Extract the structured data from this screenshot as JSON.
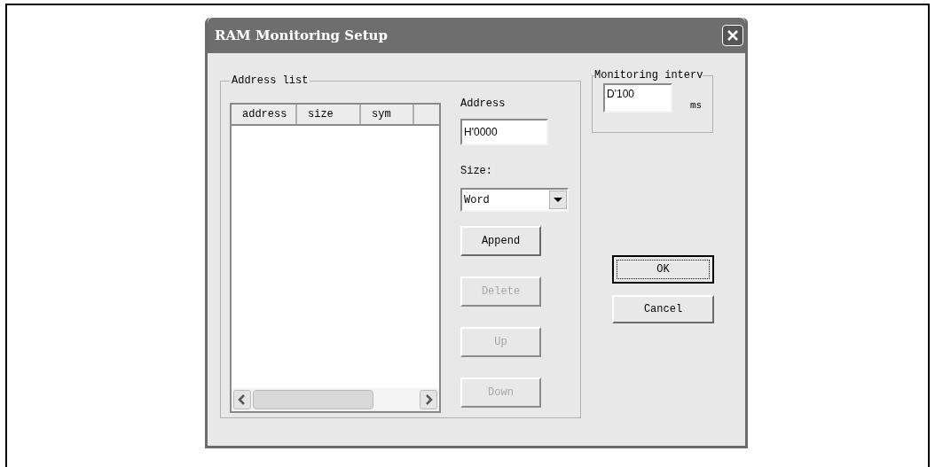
{
  "window": {
    "title": "RAM Monitoring Setup"
  },
  "address_list": {
    "label": "Address list",
    "columns": [
      "address",
      "size",
      "sym"
    ]
  },
  "address": {
    "label": "Address",
    "value": "H'0000"
  },
  "size": {
    "label": "Size:",
    "value": "Word"
  },
  "list_buttons": [
    {
      "label": "Append",
      "disabled": false
    },
    {
      "label": "Delete",
      "disabled": true
    },
    {
      "label": "Up",
      "disabled": true
    },
    {
      "label": "Down",
      "disabled": true
    }
  ],
  "monitoring": {
    "label": "Monitoring interv",
    "value": "D'100",
    "unit": "ms"
  },
  "dialog_buttons": [
    {
      "label": "OK",
      "default": true
    },
    {
      "label": "Cancel",
      "default": false
    }
  ]
}
